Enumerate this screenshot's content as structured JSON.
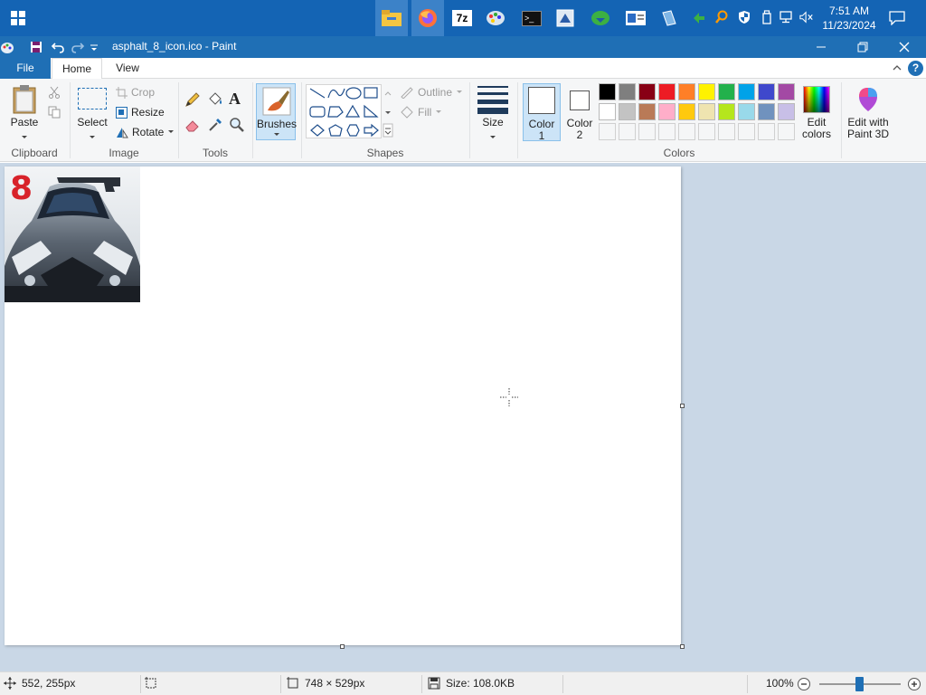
{
  "taskbar": {
    "clock_time": "7:51 AM",
    "clock_date": "11/23/2024",
    "apps": [
      "file-explorer",
      "firefox",
      "7zip",
      "paint",
      "terminal",
      "app-6",
      "app-7",
      "app-8",
      "app-9"
    ]
  },
  "window": {
    "title": "asphalt_8_icon.ico - Paint"
  },
  "ribbon_tabs": {
    "file": "File",
    "home": "Home",
    "view": "View"
  },
  "clipboard": {
    "paste": "Paste",
    "label": "Clipboard"
  },
  "image": {
    "select": "Select",
    "crop": "Crop",
    "resize": "Resize",
    "rotate": "Rotate",
    "label": "Image"
  },
  "tools": {
    "label": "Tools"
  },
  "brushes": {
    "label": "Brushes"
  },
  "shapes": {
    "outline": "Outline",
    "fill": "Fill",
    "label": "Shapes"
  },
  "size": {
    "label": "Size"
  },
  "colors": {
    "color1_label": "Color",
    "color1_num": "1",
    "color2_label": "Color",
    "color2_num": "2",
    "edit_colors_line1": "Edit",
    "edit_colors_line2": "colors",
    "label": "Colors",
    "row1": [
      "#000000",
      "#7f7f7f",
      "#880015",
      "#ed1c24",
      "#ff7f27",
      "#fff200",
      "#22b14c",
      "#00a2e8",
      "#3f48cc",
      "#a349a4"
    ],
    "row2": [
      "#ffffff",
      "#c3c3c3",
      "#b97a57",
      "#ffaec9",
      "#ffc90e",
      "#efe4b0",
      "#b5e61d",
      "#99d9ea",
      "#7092be",
      "#c8bfe7"
    ],
    "color1": "#ffffff",
    "color2": "#ffffff"
  },
  "paint3d": {
    "line1": "Edit with",
    "line2": "Paint 3D"
  },
  "image_content": {
    "badge": "8"
  },
  "status": {
    "cursor_pos": "552, 255px",
    "dimensions": "748 × 529px",
    "file_size": "Size: 108.0KB",
    "zoom": "100%"
  }
}
